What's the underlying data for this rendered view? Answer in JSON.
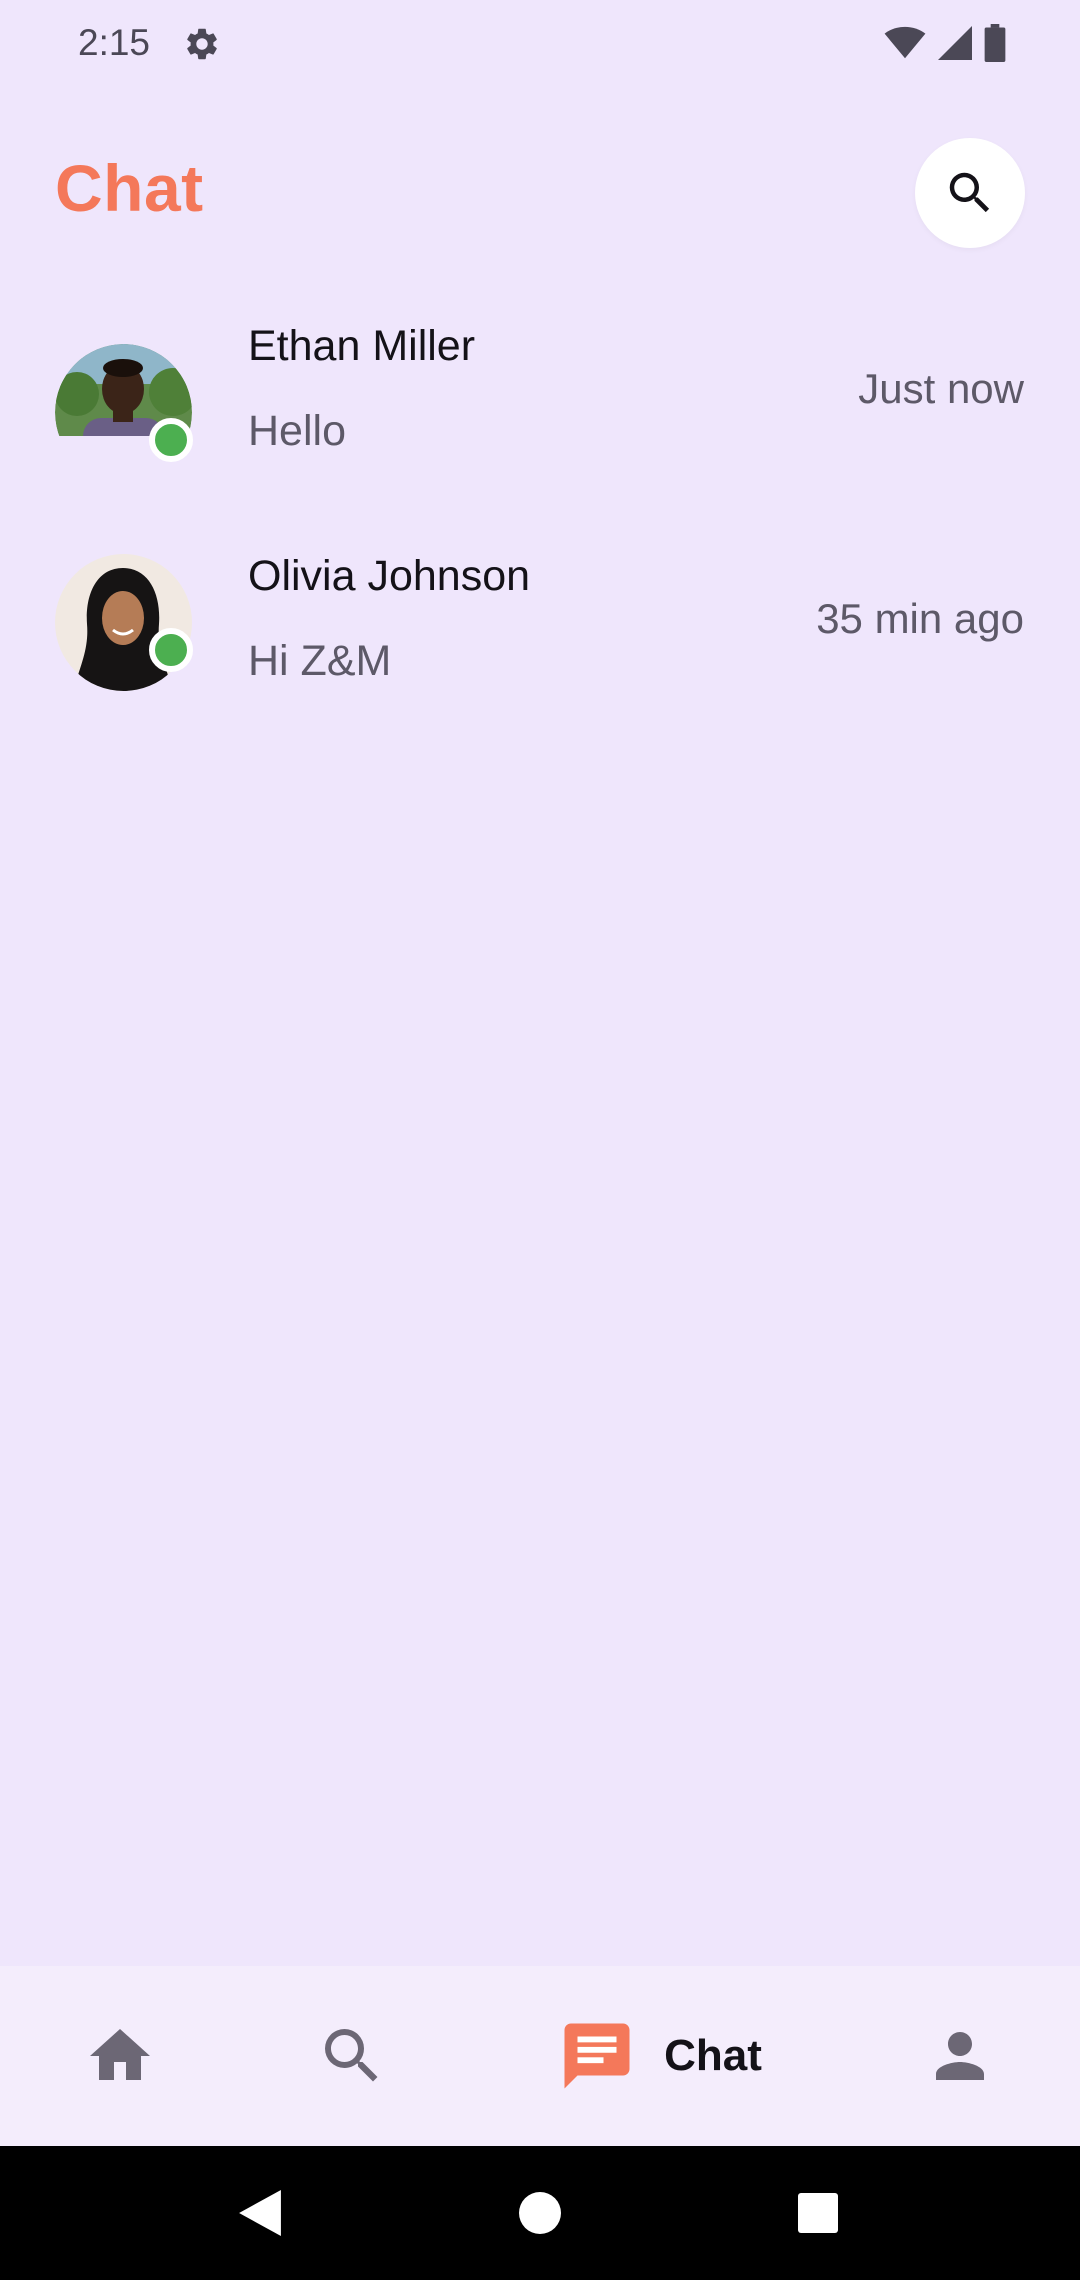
{
  "status_bar": {
    "time": "2:15",
    "icons": [
      "gear-icon",
      "wifi-icon",
      "signal-icon",
      "battery-icon"
    ]
  },
  "header": {
    "title": "Chat",
    "title_color": "#F4785A",
    "search_icon": "search-icon"
  },
  "chats": [
    {
      "name": "Ethan Miller",
      "preview": "Hello",
      "time": "Just now",
      "online": true,
      "online_color": "#4CAF50"
    },
    {
      "name": "Olivia Johnson",
      "preview": "Hi Z&M",
      "time": "35 min ago",
      "online": true,
      "online_color": "#4CAF50"
    }
  ],
  "bottom_nav": {
    "items": [
      {
        "icon": "home-icon",
        "label": "",
        "active": false
      },
      {
        "icon": "search-icon",
        "label": "",
        "active": false
      },
      {
        "icon": "chat-icon",
        "label": "Chat",
        "active": true
      },
      {
        "icon": "person-icon",
        "label": "",
        "active": false
      }
    ],
    "accent": "#F4785A"
  },
  "system_nav": {
    "icons": [
      "back-icon",
      "home-circle-icon",
      "recents-icon"
    ]
  },
  "colors": {
    "background": "#EFE6FC",
    "accent": "#F4785A",
    "online": "#4CAF50"
  }
}
